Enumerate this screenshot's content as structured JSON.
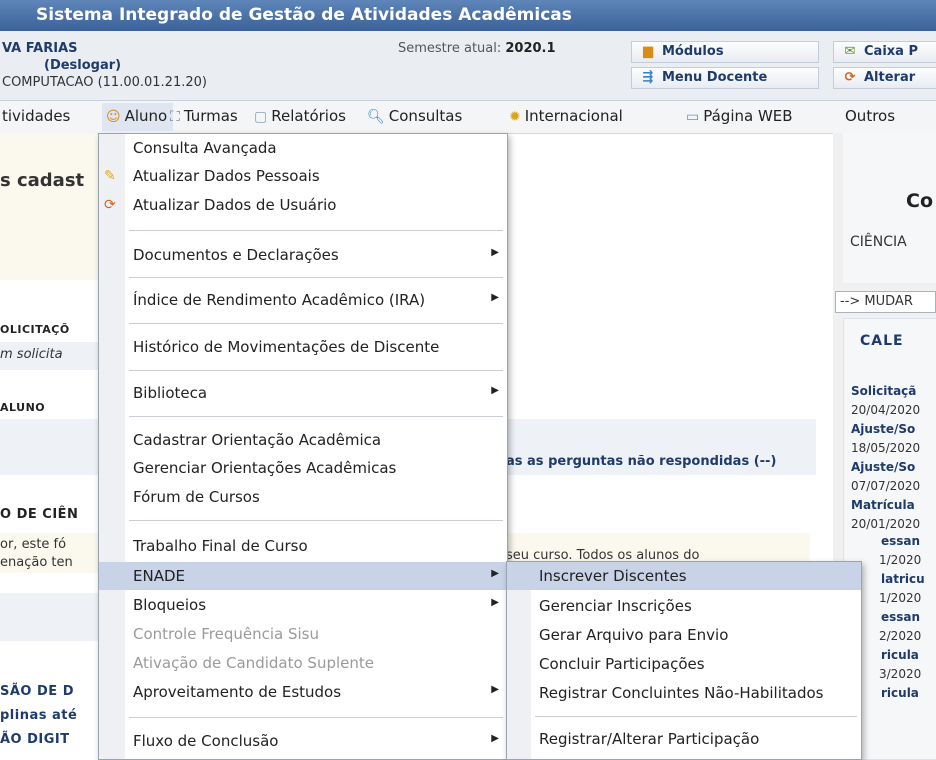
{
  "app_title": "Sistema Integrado de Gestão de Atividades Acadêmicas",
  "user": {
    "name": "VA FARIAS",
    "logout": "(Deslogar)",
    "unit": "COMPUTACAO (11.00.01.21.20)"
  },
  "semester": {
    "label": "Semestre atual:",
    "value": "2020.1"
  },
  "quick_buttons": {
    "modules": "Módulos",
    "teacher_menu": "Menu Docente",
    "inbox": "Caixa P",
    "change": "Alterar"
  },
  "menubar": {
    "items": [
      "tividades",
      "Aluno",
      "Turmas",
      "Relatórios",
      "Consultas",
      "Internacional",
      "Página WEB",
      "Outros"
    ]
  },
  "background": {
    "cadast": "s cadast",
    "solicitacoes_header": "OLICITAÇÕ",
    "solicitacoes_text": "m solicita",
    "aluno_header": "ALUNO",
    "perguntas": "as as perguntas não respondidas (--)",
    "ciencia_header": "O DE CIÊN",
    "forum_text1": "or, este fó",
    "forum_text2": "enação ten",
    "forum_text3": "seu curso. Todos os alunos do",
    "sao_de": "SÃO DE D",
    "plinas_ate": "plinas até",
    "ao_digit": "ÃO DIGIT",
    "co": "Co",
    "ciencia": "CIÊNCIA",
    "mudar": "--> MUDAR",
    "calendar_title": "CALE",
    "calendar_items": [
      "Solicitaçã",
      "20/04/2020",
      "Ajuste/So",
      "18/05/2020",
      "Ajuste/So",
      "07/07/2020",
      "Matrícula",
      "20/01/2020",
      "essan",
      "1/2020",
      "latricu",
      "1/2020",
      "essan",
      "2/2020",
      "ricula",
      "3/2020",
      "ricula"
    ]
  },
  "dropdown": {
    "items": [
      "Consulta Avançada",
      "Atualizar Dados Pessoais",
      "Atualizar Dados de Usuário",
      "Documentos e Declarações",
      "Índice de Rendimento Acadêmico (IRA)",
      "Histórico de Movimentações de Discente",
      "Biblioteca",
      "Cadastrar Orientação Acadêmica",
      "Gerenciar Orientações Acadêmicas",
      "Fórum de Cursos",
      "Trabalho Final de Curso",
      "ENADE",
      "Bloqueios",
      "Controle Frequência Sisu",
      "Ativação de Candidato Suplente",
      "Aproveitamento de Estudos",
      "Fluxo de Conclusão"
    ]
  },
  "submenu": {
    "items": [
      "Inscrever Discentes",
      "Gerenciar Inscrições",
      "Gerar Arquivo para Envio",
      "Concluir Participações",
      "Registrar Concluintes Não-Habilitados",
      "Registrar/Alterar Participação"
    ]
  },
  "colors": {
    "title_bar": "#3a6199",
    "highlight": "#c8d3e8"
  }
}
